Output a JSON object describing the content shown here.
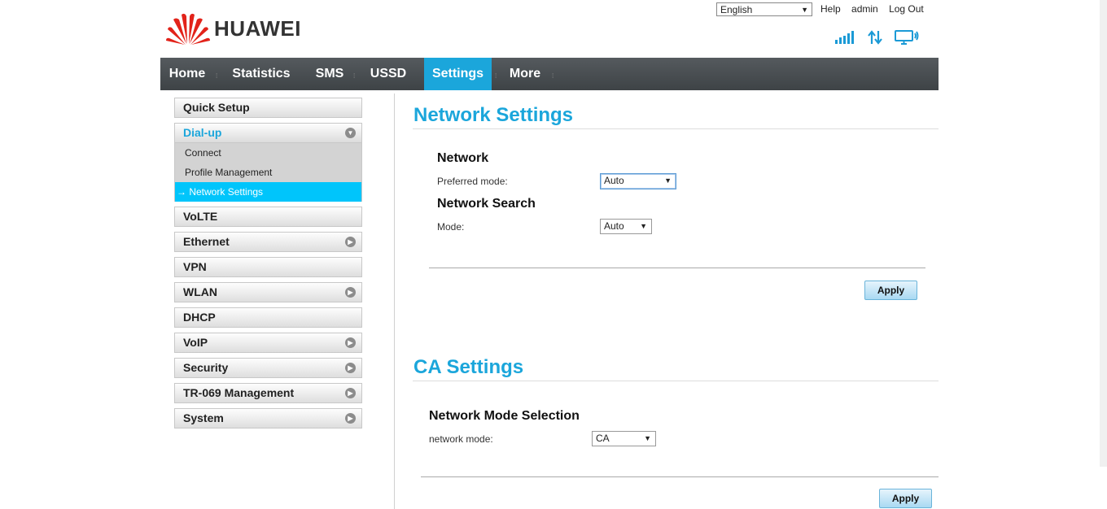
{
  "brand": {
    "name": "HUAWEI",
    "logo_icon": "huawei-petal-logo",
    "color": "#e2231a"
  },
  "header": {
    "language": "English",
    "links": [
      "Help",
      "admin",
      "Log Out"
    ],
    "status_icons": [
      "signal-icon",
      "data-transfer-icon",
      "wifi-monitor-icon"
    ]
  },
  "nav": {
    "items": [
      "Home",
      "Statistics",
      "SMS",
      "USSD",
      "Settings",
      "More"
    ],
    "active": "Settings",
    "active_color": "#1ba6db"
  },
  "sidebar": {
    "quick_setup": "Quick Setup",
    "dialup": {
      "label": "Dial-up",
      "children": [
        "Connect",
        "Profile Management",
        "Network Settings"
      ],
      "active_child_prefix": "→"
    },
    "items": [
      "VoLTE",
      "Ethernet",
      "VPN",
      "WLAN",
      "DHCP",
      "VoIP",
      "Security",
      "TR-069 Management",
      "System"
    ]
  },
  "network_settings": {
    "title": "Network Settings",
    "network_heading": "Network",
    "preferred_mode_label": "Preferred mode:",
    "preferred_mode_value": "Auto",
    "search_heading": "Network Search",
    "search_mode_label": "Mode:",
    "search_mode_value": "Auto",
    "apply_label": "Apply"
  },
  "ca_settings": {
    "title": "CA Settings",
    "mode_heading": "Network Mode Selection",
    "mode_label": "network mode:",
    "mode_value": "CA",
    "apply_label": "Apply"
  }
}
